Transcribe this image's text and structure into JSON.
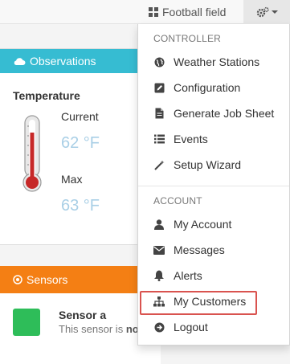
{
  "topbar": {
    "field_label": "Football field",
    "grid_icon": "grid-icon",
    "gear_icon": "gears-icon"
  },
  "observations": {
    "header": "Observations",
    "header_icon": "cloud-icon",
    "title": "Temperature",
    "current_label": "Current",
    "current_value": "62 °F",
    "max_label": "Max",
    "max_value": "63 °F",
    "thermometer_icon": "thermometer-icon"
  },
  "sensors": {
    "header": "Sensors",
    "header_icon": "target-icon",
    "sensor_name": "Sensor a",
    "sensor_desc_prefix": "This sensor is ",
    "sensor_desc_bold": "no",
    "status_color": "#2ebd59"
  },
  "menu": {
    "controller_header": "CONTROLLER",
    "controller_items": [
      {
        "label": "Weather Stations",
        "icon": "globe-icon"
      },
      {
        "label": "Configuration",
        "icon": "edit-icon"
      },
      {
        "label": "Generate Job Sheet",
        "icon": "document-icon"
      },
      {
        "label": "Events",
        "icon": "list-icon"
      },
      {
        "label": "Setup Wizard",
        "icon": "wand-icon"
      }
    ],
    "account_header": "ACCOUNT",
    "account_items": [
      {
        "label": "My Account",
        "icon": "user-icon"
      },
      {
        "label": "Messages",
        "icon": "envelope-icon"
      },
      {
        "label": "Alerts",
        "icon": "bell-icon"
      },
      {
        "label": "My Customers",
        "icon": "sitemap-icon"
      },
      {
        "label": "Logout",
        "icon": "logout-icon"
      }
    ]
  },
  "colors": {
    "observations_header": "#36bcd2",
    "sensors_header": "#f47f14",
    "highlight": "#d9534f",
    "value_text": "#a9cfe6"
  }
}
